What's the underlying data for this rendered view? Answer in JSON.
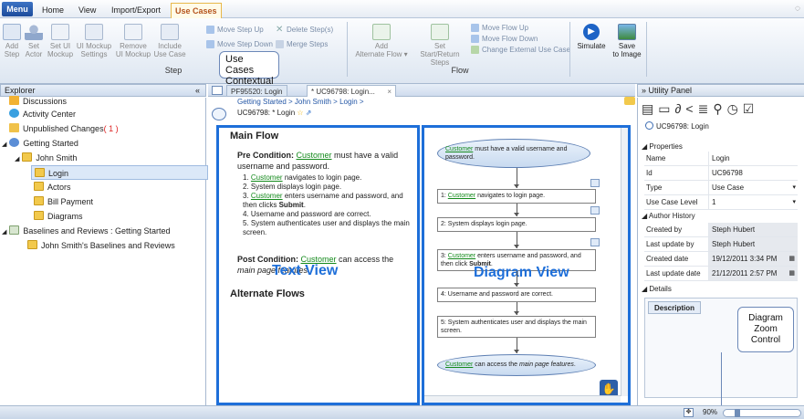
{
  "menubar": {
    "menu_label": "Menu",
    "tabs": [
      "Home",
      "View",
      "Import/Export",
      "Use Cases"
    ],
    "active_tab": "Use Cases"
  },
  "ribbon": {
    "step_group": {
      "label": "Step",
      "buttons": [
        {
          "line1": "Add",
          "line2": "Step"
        },
        {
          "line1": "Set",
          "line2": "Actor"
        },
        {
          "line1": "Set UI",
          "line2": "Mockup"
        },
        {
          "line1": "UI Mockup",
          "line2": "Settings"
        },
        {
          "line1": "Remove",
          "line2": "UI Mockup"
        },
        {
          "line1": "Include",
          "line2": "Use Case"
        }
      ],
      "row_items": [
        "Move Step Up",
        "Delete Step(s)",
        "Move Step Down",
        "Merge Steps"
      ]
    },
    "flow_group": {
      "label": "Flow",
      "add_alternate": {
        "line1": "Add",
        "line2": "Alternate Flow ▾"
      },
      "set_start": {
        "line1": "Set",
        "line2": "Start/Return Steps"
      },
      "row_items": [
        "Move Flow Up",
        "Move Flow Down",
        "Change External Use Case"
      ]
    },
    "simulate": "Simulate",
    "save_to_image": {
      "line1": "Save",
      "line2": "to Image"
    }
  },
  "callouts": {
    "contextual": {
      "line1": "Use Cases",
      "line2": "Contextual"
    },
    "text_view": "Text View",
    "diagram_view": "Diagram View",
    "zoom": {
      "line1": "Diagram",
      "line2": "Zoom",
      "line3": "Control"
    }
  },
  "explorer": {
    "title": "Explorer",
    "collapse": "«",
    "items": [
      {
        "label": "Discussions"
      },
      {
        "label": "Activity Center"
      },
      {
        "label": "Unpublished Changes",
        "count": "( 1 )"
      },
      {
        "label": "Getting Started"
      },
      {
        "label": "John Smith"
      },
      {
        "label": "Login"
      },
      {
        "label": "Actors"
      },
      {
        "label": "Bill Payment"
      },
      {
        "label": "Diagrams"
      },
      {
        "label": "Baselines and Reviews : Getting Started"
      },
      {
        "label": "John Smith's Baselines and Reviews"
      }
    ]
  },
  "doc_tabs": {
    "tab1": "PF95520: Login",
    "tab2": "* UC96798: Login...",
    "close": "×"
  },
  "breadcrumb": {
    "path": "Getting Started > John Smith > Login >",
    "title": "UC96798: * Login"
  },
  "text_view": {
    "main_flow": "Main Flow",
    "pre_label": "Pre Condition:",
    "pre_link": "Customer",
    "pre_text": "must have a valid username and password.",
    "steps": [
      {
        "num": "1.",
        "link": "Customer",
        "text": "navigates to login page."
      },
      {
        "num": "2.",
        "link": "",
        "text": "System displays login page."
      },
      {
        "num": "3.",
        "link": "Customer",
        "text": "enters username and password, and then clicks",
        "bold": "Submit",
        "end": "."
      },
      {
        "num": "4.",
        "link": "",
        "text": "Username and password are correct."
      },
      {
        "num": "5.",
        "link": "",
        "text": "System authenticates user and displays the main screen."
      }
    ],
    "post_label": "Post Condition:",
    "post_link": "Customer",
    "post_text": "can access the",
    "post_italic": "main page features",
    "post_end": ".",
    "alternate_flows": "Alternate Flows"
  },
  "diagram": {
    "start_link": "Customer",
    "start_text": "must have a valid username and password.",
    "boxes": [
      {
        "prefix": "1:",
        "link": "Customer",
        "text": "navigates to login page."
      },
      {
        "prefix": "2:",
        "link": "",
        "text": "System displays login page."
      },
      {
        "prefix": "3:",
        "link": "Customer",
        "text": "enters username and password, and then click",
        "bold": "Submit",
        "end": "."
      },
      {
        "prefix": "4:",
        "link": "",
        "text": "Username and password are correct."
      },
      {
        "prefix": "5:",
        "link": "",
        "text": "System authenticates user and displays the main screen."
      }
    ],
    "end_link": "Customer",
    "end_text": "can access the",
    "end_italic": "main page features",
    "end_end": "."
  },
  "utility": {
    "title": "» Utility Panel",
    "item": "UC96798: Login",
    "properties_label": "◢ Properties",
    "properties": [
      {
        "key": "Name",
        "value": "Login",
        "editable": true
      },
      {
        "key": "Id",
        "value": "UC96798",
        "editable": true
      },
      {
        "key": "Type",
        "value": "Use Case",
        "editable": true
      },
      {
        "key": "Use Case Level",
        "value": "1",
        "editable": true
      }
    ],
    "author_label": "◢ Author History",
    "author": [
      {
        "key": "Created by",
        "value": "Steph Hubert"
      },
      {
        "key": "Last update by",
        "value": "Steph Hubert"
      },
      {
        "key": "Created date",
        "value": "19/12/2011 3:34 PM"
      },
      {
        "key": "Last update date",
        "value": "21/12/2011 2:57 PM"
      }
    ],
    "details_label": "◢ Details",
    "description_tab": "Description"
  },
  "status": {
    "zoom": "90%"
  },
  "colors": {
    "accent_blue": "#1e6fd9",
    "link_green": "#148a1c",
    "tab_orange": "#e8b84a"
  }
}
